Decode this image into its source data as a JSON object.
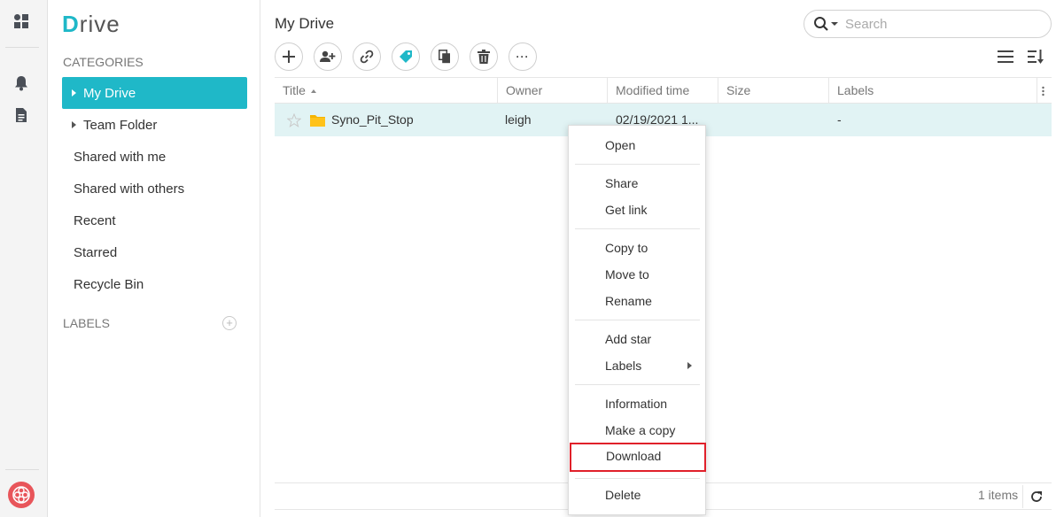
{
  "app": {
    "logo_letter": "D",
    "logo_rest": "rive",
    "accent_color": "#1fb8c8"
  },
  "rail": {
    "icons": [
      "apps-icon",
      "bell-icon",
      "document-icon",
      "user-avatar-icon"
    ]
  },
  "sidebar": {
    "categories_label": "CATEGORIES",
    "labels_label": "LABELS",
    "add_label_glyph": "+",
    "items": [
      {
        "label": "My Drive",
        "active": true,
        "expandable": true
      },
      {
        "label": "Team Folder",
        "active": false,
        "expandable": true
      },
      {
        "label": "Shared with me"
      },
      {
        "label": "Shared with others"
      },
      {
        "label": "Recent"
      },
      {
        "label": "Starred"
      },
      {
        "label": "Recycle Bin"
      }
    ]
  },
  "main": {
    "title": "My Drive",
    "search_placeholder": "Search",
    "toolbar": [
      "add-icon",
      "add-user-icon",
      "link-icon",
      "tag-icon",
      "copy-icon",
      "trash-icon",
      "more-icon"
    ],
    "more_glyph": "···",
    "columns": {
      "title": "Title",
      "owner": "Owner",
      "modified": "Modified time",
      "size": "Size",
      "labels": "Labels"
    },
    "rows": [
      {
        "title": "Syno_Pit_Stop",
        "owner": "leigh",
        "modified": "02/19/2021 1...",
        "size": "",
        "labels": "-"
      }
    ],
    "items_count": "1 items"
  },
  "context_menu": {
    "items": {
      "open": "Open",
      "share": "Share",
      "get_link": "Get link",
      "copy_to": "Copy to",
      "move_to": "Move to",
      "rename": "Rename",
      "add_star": "Add star",
      "labels": "Labels",
      "information": "Information",
      "make_copy": "Make a copy",
      "download": "Download",
      "delete": "Delete"
    },
    "highlighted": "Download",
    "highlight_color": "#e0202a"
  }
}
